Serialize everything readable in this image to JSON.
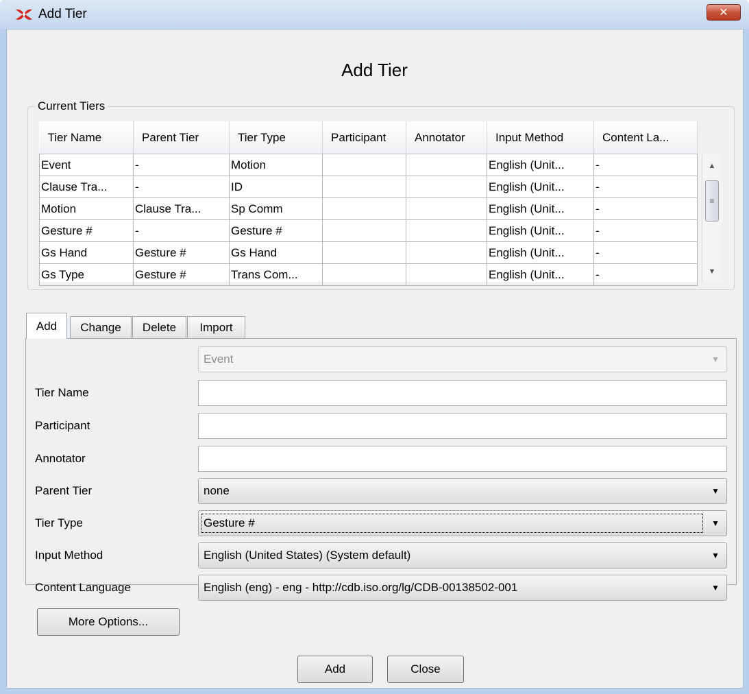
{
  "window": {
    "title": "Add Tier",
    "heading": "Add Tier",
    "close_glyph": "✕",
    "app_icon": "elan-app-icon",
    "close_icon": "close-icon"
  },
  "current_tiers": {
    "label": "Current Tiers",
    "columns": [
      "Tier Name",
      "Parent Tier",
      "Tier Type",
      "Participant",
      "Annotator",
      "Input Method",
      "Content La..."
    ],
    "rows": [
      [
        "Event",
        "-",
        "Motion",
        "",
        "",
        "English (Unit...",
        "-"
      ],
      [
        "Clause Tra...",
        "-",
        "ID",
        "",
        "",
        "English (Unit...",
        "-"
      ],
      [
        "Motion",
        "Clause Tra...",
        "Sp Comm",
        "",
        "",
        "English (Unit...",
        "-"
      ],
      [
        "Gesture #",
        "-",
        "Gesture #",
        "",
        "",
        "English (Unit...",
        "-"
      ],
      [
        "Gs Hand",
        "Gesture #",
        "Gs Hand",
        "",
        "",
        "English (Unit...",
        "-"
      ],
      [
        "Gs Type",
        "Gesture #",
        "Trans Com...",
        "",
        "",
        "English (Unit...",
        "-"
      ]
    ]
  },
  "tabs": [
    {
      "label": "Add",
      "active": true
    },
    {
      "label": "Change",
      "active": false
    },
    {
      "label": "Delete",
      "active": false
    },
    {
      "label": "Import",
      "active": false
    }
  ],
  "form": {
    "tier_selector_value": "Event",
    "tier_name_label": "Tier Name",
    "tier_name_value": "",
    "participant_label": "Participant",
    "participant_value": "",
    "annotator_label": "Annotator",
    "annotator_value": "",
    "parent_tier_label": "Parent Tier",
    "parent_tier_value": "none",
    "tier_type_label": "Tier Type",
    "tier_type_value": "Gesture #",
    "input_method_label": "Input Method",
    "input_method_value": "English (United States) (System default)",
    "content_language_label": "Content Language",
    "content_language_value": "English (eng) - eng - http://cdb.iso.org/lg/CDB-00138502-001",
    "more_options_label": "More Options..."
  },
  "buttons": {
    "add_label": "Add",
    "close_label": "Close"
  },
  "colors": {
    "accent_close": "#c9523b",
    "frame": "#b9d1ea",
    "panel": "#f0f0f0"
  }
}
